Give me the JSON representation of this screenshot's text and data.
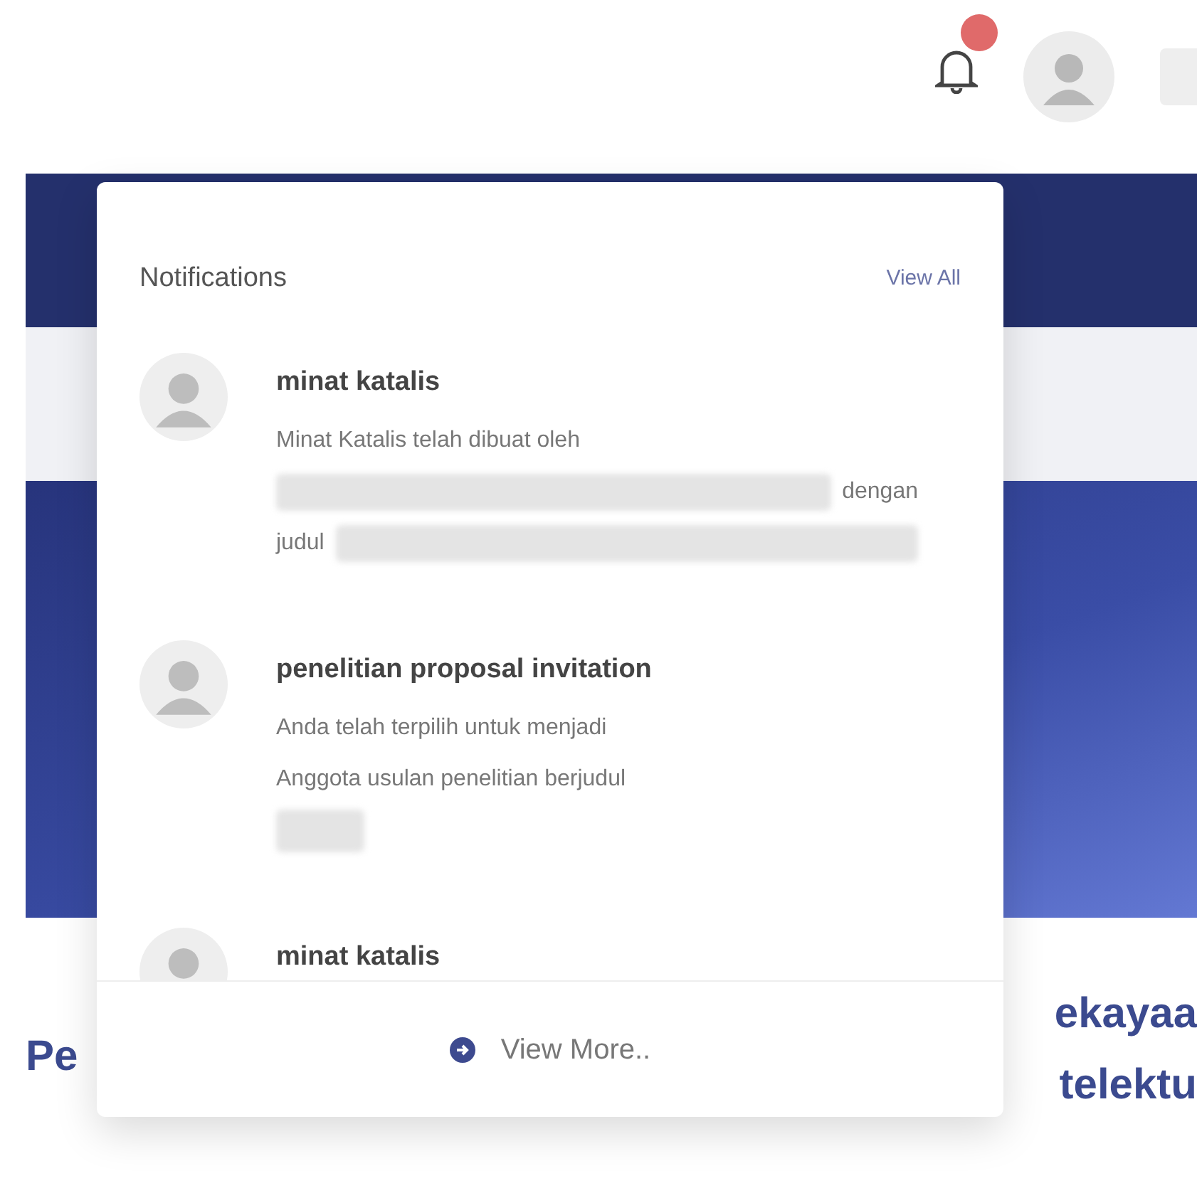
{
  "header": {
    "notification_badge": true
  },
  "background_headings": [
    "Pe",
    "ekayaa",
    "telektu"
  ],
  "notifications_panel": {
    "title": "Notifications",
    "view_all": "View All",
    "items": [
      {
        "title": "minat katalis",
        "lines": [
          [
            {
              "kind": "text",
              "text": "Minat Katalis telah dibuat oleh"
            }
          ],
          [
            {
              "kind": "redacted"
            },
            {
              "kind": "text",
              "text": "dengan"
            }
          ],
          [
            {
              "kind": "text",
              "text": "judul"
            },
            {
              "kind": "redacted"
            }
          ]
        ]
      },
      {
        "title": "penelitian proposal invitation",
        "lines": [
          [
            {
              "kind": "text",
              "text": "Anda telah terpilih untuk menjadi"
            }
          ],
          [
            {
              "kind": "text",
              "text": "Anggota usulan penelitian berjudul"
            }
          ],
          [
            {
              "kind": "redacted_short"
            }
          ]
        ]
      },
      {
        "title": "minat katalis"
      }
    ],
    "view_more": "View More.."
  }
}
